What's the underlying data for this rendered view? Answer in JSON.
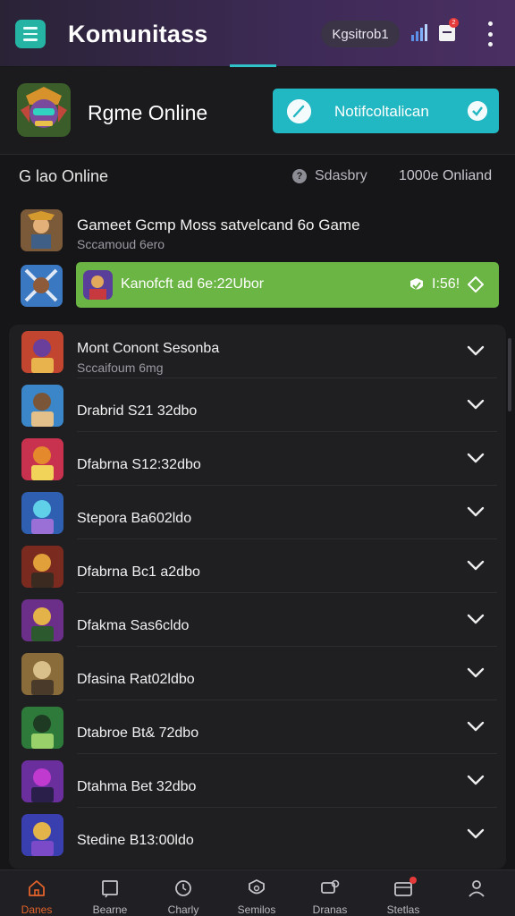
{
  "header": {
    "title": "Komunitass",
    "search_chip": "Kgsitrob1",
    "notification_count": "2"
  },
  "hero": {
    "title": "Rgme Online",
    "notification_button": "Notifcoltalican"
  },
  "status": {
    "left": "G lao Online",
    "middle": "Sdasbry",
    "right": "1000e Onliand"
  },
  "featured": {
    "title": "Gameet Gcmp Moss satvelcand 6o Game",
    "subtitle": "Sccamoud 6ero",
    "highlight_label": "Kanofcft ad 6e:22Ubor",
    "highlight_count": "I:56!"
  },
  "list": [
    {
      "name": "Mont Conont Sesonba",
      "sub": "Sccaifoum 6mg",
      "icon": "hero-icon"
    },
    {
      "name": "Drabrid S21 32dbo",
      "sub": "",
      "icon": "warrior-icon"
    },
    {
      "name": "Dfabrna S12:32dbo",
      "sub": "",
      "icon": "flame-icon"
    },
    {
      "name": "Stepora Ba602ldo",
      "sub": "",
      "icon": "mage-icon"
    },
    {
      "name": "Dfabrna Bc1 a2dbo",
      "sub": "",
      "icon": "knight-icon"
    },
    {
      "name": "Dfakma Sas6cldo",
      "sub": "",
      "icon": "arena-icon"
    },
    {
      "name": "Dfasina Rat02ldbo",
      "sub": "",
      "icon": "soldier-icon"
    },
    {
      "name": "Dtabroe Bt& 72dbo",
      "sub": "",
      "icon": "ranger-icon"
    },
    {
      "name": "Dtahma Bet 32dbo",
      "sub": "",
      "icon": "sorcerer-icon"
    },
    {
      "name": "Stedine B13:00ldo",
      "sub": "",
      "icon": "champion-icon"
    }
  ],
  "nav": [
    {
      "label": "Danes",
      "icon": "home-icon",
      "active": true
    },
    {
      "label": "Bearne",
      "icon": "frame-icon",
      "active": false
    },
    {
      "label": "Charly",
      "icon": "clock-icon",
      "active": false
    },
    {
      "label": "Semilos",
      "icon": "shield-icon",
      "active": false
    },
    {
      "label": "Dranas",
      "icon": "chat-icon",
      "active": false
    },
    {
      "label": "Stetlas",
      "icon": "wallet-icon",
      "active": false
    },
    {
      "label": "",
      "icon": "person-icon",
      "active": false
    }
  ],
  "colors": {
    "appbar": "#3d2a55",
    "accent_teal": "#21b7c3",
    "highlight_green": "#6bb545",
    "active_nav": "#e2622a"
  }
}
